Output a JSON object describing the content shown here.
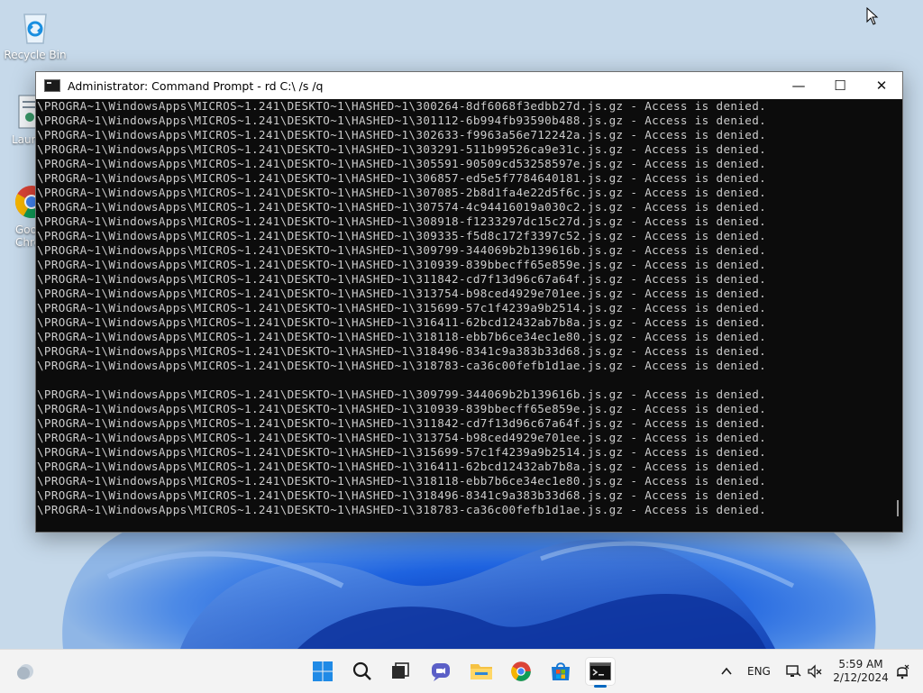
{
  "desktop": {
    "icons": [
      {
        "label": "Recycle Bin"
      },
      {
        "label": "Laun"
      },
      {
        "label": "Goo\nChro"
      }
    ]
  },
  "window": {
    "title": "Administrator: Command Prompt - rd  C:\\ /s /q",
    "controls": {
      "minimize": "—",
      "maximize": "☐",
      "close": "✕"
    }
  },
  "console": {
    "lines": [
      "\\PROGRA~1\\WindowsApps\\MICROS~1.241\\DESKTO~1\\HASHED~1\\300264-8df6068f3edbb27d.js.gz - Access is denied.",
      "\\PROGRA~1\\WindowsApps\\MICROS~1.241\\DESKTO~1\\HASHED~1\\301112-6b994fb93590b488.js.gz - Access is denied.",
      "\\PROGRA~1\\WindowsApps\\MICROS~1.241\\DESKTO~1\\HASHED~1\\302633-f9963a56e712242a.js.gz - Access is denied.",
      "\\PROGRA~1\\WindowsApps\\MICROS~1.241\\DESKTO~1\\HASHED~1\\303291-511b99526ca9e31c.js.gz - Access is denied.",
      "\\PROGRA~1\\WindowsApps\\MICROS~1.241\\DESKTO~1\\HASHED~1\\305591-90509cd53258597e.js.gz - Access is denied.",
      "\\PROGRA~1\\WindowsApps\\MICROS~1.241\\DESKTO~1\\HASHED~1\\306857-ed5e5f7784640181.js.gz - Access is denied.",
      "\\PROGRA~1\\WindowsApps\\MICROS~1.241\\DESKTO~1\\HASHED~1\\307085-2b8d1fa4e22d5f6c.js.gz - Access is denied.",
      "\\PROGRA~1\\WindowsApps\\MICROS~1.241\\DESKTO~1\\HASHED~1\\307574-4c94416019a030c2.js.gz - Access is denied.",
      "\\PROGRA~1\\WindowsApps\\MICROS~1.241\\DESKTO~1\\HASHED~1\\308918-f1233297dc15c27d.js.gz - Access is denied.",
      "\\PROGRA~1\\WindowsApps\\MICROS~1.241\\DESKTO~1\\HASHED~1\\309335-f5d8c172f3397c52.js.gz - Access is denied.",
      "\\PROGRA~1\\WindowsApps\\MICROS~1.241\\DESKTO~1\\HASHED~1\\309799-344069b2b139616b.js.gz - Access is denied.",
      "\\PROGRA~1\\WindowsApps\\MICROS~1.241\\DESKTO~1\\HASHED~1\\310939-839bbecff65e859e.js.gz - Access is denied.",
      "\\PROGRA~1\\WindowsApps\\MICROS~1.241\\DESKTO~1\\HASHED~1\\311842-cd7f13d96c67a64f.js.gz - Access is denied.",
      "\\PROGRA~1\\WindowsApps\\MICROS~1.241\\DESKTO~1\\HASHED~1\\313754-b98ced4929e701ee.js.gz - Access is denied.",
      "\\PROGRA~1\\WindowsApps\\MICROS~1.241\\DESKTO~1\\HASHED~1\\315699-57c1f4239a9b2514.js.gz - Access is denied.",
      "\\PROGRA~1\\WindowsApps\\MICROS~1.241\\DESKTO~1\\HASHED~1\\316411-62bcd12432ab7b8a.js.gz - Access is denied.",
      "\\PROGRA~1\\WindowsApps\\MICROS~1.241\\DESKTO~1\\HASHED~1\\318118-ebb7b6ce34ec1e80.js.gz - Access is denied.",
      "\\PROGRA~1\\WindowsApps\\MICROS~1.241\\DESKTO~1\\HASHED~1\\318496-8341c9a383b33d68.js.gz - Access is denied.",
      "\\PROGRA~1\\WindowsApps\\MICROS~1.241\\DESKTO~1\\HASHED~1\\318783-ca36c00fefb1d1ae.js.gz - Access is denied.",
      "",
      "\\PROGRA~1\\WindowsApps\\MICROS~1.241\\DESKTO~1\\HASHED~1\\309799-344069b2b139616b.js.gz - Access is denied.",
      "\\PROGRA~1\\WindowsApps\\MICROS~1.241\\DESKTO~1\\HASHED~1\\310939-839bbecff65e859e.js.gz - Access is denied.",
      "\\PROGRA~1\\WindowsApps\\MICROS~1.241\\DESKTO~1\\HASHED~1\\311842-cd7f13d96c67a64f.js.gz - Access is denied.",
      "\\PROGRA~1\\WindowsApps\\MICROS~1.241\\DESKTO~1\\HASHED~1\\313754-b98ced4929e701ee.js.gz - Access is denied.",
      "\\PROGRA~1\\WindowsApps\\MICROS~1.241\\DESKTO~1\\HASHED~1\\315699-57c1f4239a9b2514.js.gz - Access is denied.",
      "\\PROGRA~1\\WindowsApps\\MICROS~1.241\\DESKTO~1\\HASHED~1\\316411-62bcd12432ab7b8a.js.gz - Access is denied.",
      "\\PROGRA~1\\WindowsApps\\MICROS~1.241\\DESKTO~1\\HASHED~1\\318118-ebb7b6ce34ec1e80.js.gz - Access is denied.",
      "\\PROGRA~1\\WindowsApps\\MICROS~1.241\\DESKTO~1\\HASHED~1\\318496-8341c9a383b33d68.js.gz - Access is denied.",
      "\\PROGRA~1\\WindowsApps\\MICROS~1.241\\DESKTO~1\\HASHED~1\\318783-ca36c00fefb1d1ae.js.gz - Access is denied."
    ]
  },
  "taskbar": {
    "apps": [
      {
        "name": "start-icon"
      },
      {
        "name": "search-icon"
      },
      {
        "name": "task-view-icon"
      },
      {
        "name": "chat-icon"
      },
      {
        "name": "file-explorer-icon"
      },
      {
        "name": "chrome-icon"
      },
      {
        "name": "store-icon"
      },
      {
        "name": "command-prompt-icon"
      }
    ],
    "tray": {
      "language": "ENG",
      "time": "5:59 AM",
      "date": "2/12/2024"
    }
  },
  "colors": {
    "console_bg": "#0c0c0c",
    "console_fg": "#cccccc",
    "accent": "#0067c0"
  }
}
